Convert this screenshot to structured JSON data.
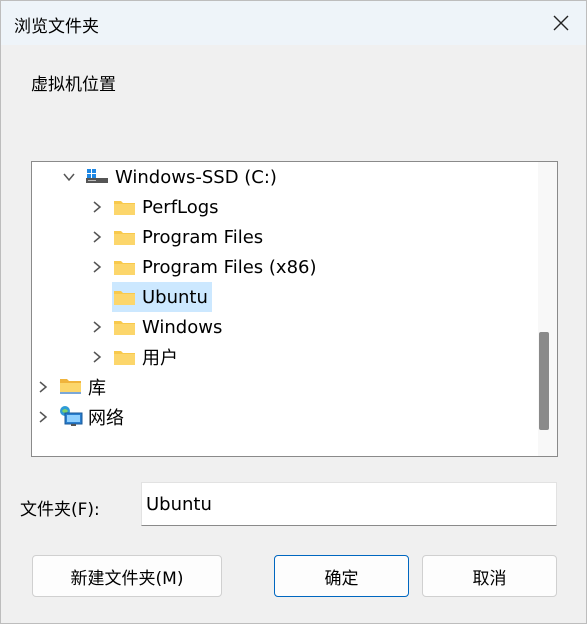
{
  "window": {
    "title": "浏览文件夹"
  },
  "description": "虚拟机位置",
  "tree": {
    "items": [
      {
        "label": "Windows-SSD (C:)",
        "icon": "drive-icon",
        "expanded": true
      },
      {
        "label": "PerfLogs",
        "icon": "folder-icon"
      },
      {
        "label": "Program Files",
        "icon": "folder-icon"
      },
      {
        "label": "Program Files (x86)",
        "icon": "folder-icon"
      },
      {
        "label": "Ubuntu",
        "icon": "folder-icon",
        "selected": true
      },
      {
        "label": "Windows",
        "icon": "folder-icon"
      },
      {
        "label": "用户",
        "icon": "folder-icon"
      },
      {
        "label": "库",
        "icon": "library-folder-icon"
      },
      {
        "label": "网络",
        "icon": "network-icon"
      }
    ]
  },
  "folder_field": {
    "label": "文件夹(F):",
    "value": "Ubuntu"
  },
  "buttons": {
    "new_folder": "新建文件夹(M)",
    "ok": "确定",
    "cancel": "取消"
  },
  "colors": {
    "selection": "#cce8ff",
    "folder": "#f8c94c",
    "accent": "#0067c0"
  }
}
